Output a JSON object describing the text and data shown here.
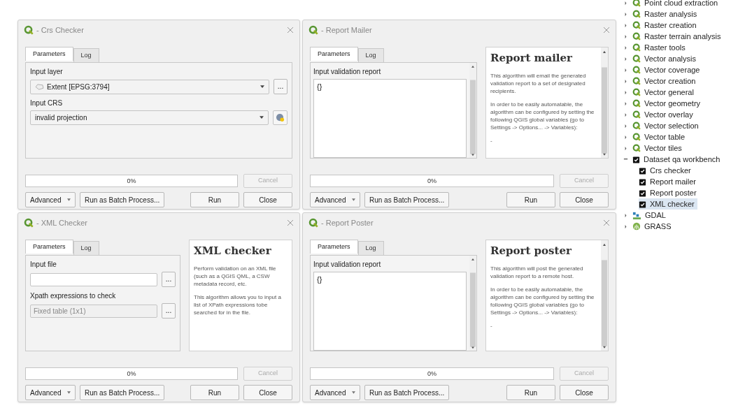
{
  "dialogs": [
    {
      "title": "- Crs Checker",
      "tabs": [
        {
          "label": "Parameters",
          "selected": true
        },
        {
          "label": "Log",
          "selected": false
        }
      ],
      "params": [
        {
          "kind": "layer",
          "label": "Input layer",
          "value": "Extent [EPSG:3794]",
          "browse": "..."
        },
        {
          "kind": "crs",
          "label": "Input CRS",
          "value": "invalid projection"
        }
      ],
      "progress": {
        "text": "0%",
        "level": 0
      },
      "buttons": {
        "advanced": "Advanced",
        "batch": "Run as Batch Process...",
        "run": "Run",
        "close": "Close",
        "cancel": "Cancel",
        "cancel_disabled": true
      }
    },
    {
      "title": "- Report Mailer",
      "tabs": [
        {
          "label": "Parameters",
          "selected": true
        },
        {
          "label": "Log",
          "selected": false
        }
      ],
      "params": [
        {
          "kind": "textarea",
          "label": "Input validation report",
          "value": "{}"
        }
      ],
      "help": {
        "heading": "Report mailer",
        "paragraphs": [
          "This algorithm will email the generated validation report to a set of designated recipients.",
          "In order to be easily automatable, the algorithm can be configured by setting the following QGIS global variables (go to Settings -> Options... -> Variables):",
          "-"
        ]
      },
      "progress": {
        "text": "0%",
        "level": 0
      },
      "buttons": {
        "advanced": "Advanced",
        "batch": "Run as Batch Process...",
        "run": "Run",
        "close": "Close",
        "cancel": "Cancel",
        "cancel_disabled": true
      }
    },
    {
      "title": "- XML Checker",
      "tabs": [
        {
          "label": "Parameters",
          "selected": true
        },
        {
          "label": "Log",
          "selected": false
        }
      ],
      "params": [
        {
          "kind": "file",
          "label": "Input file",
          "browse": "..."
        },
        {
          "kind": "table",
          "label": "Xpath expressions to check",
          "value": "Fixed table (1x1)",
          "disabled": true,
          "browse": "..."
        }
      ],
      "help": {
        "heading": "XML checker",
        "paragraphs": [
          "Perform validation on an XML file (such as a QGIS QML, a CSW metadata record, etc.",
          "This algorithm allows you to input a list of XPath expressions tobe searched for in the file."
        ]
      },
      "progress": {
        "text": "0%",
        "level": 0
      },
      "buttons": {
        "advanced": "Advanced",
        "batch": "Run as Batch Process...",
        "run": "Run",
        "close": "Close",
        "cancel": "Cancel",
        "cancel_disabled": true
      }
    },
    {
      "title": "- Report Poster",
      "tabs": [
        {
          "label": "Parameters",
          "selected": true
        },
        {
          "label": "Log",
          "selected": false
        }
      ],
      "params": [
        {
          "kind": "textarea",
          "label": "Input validation report",
          "value": "{}"
        }
      ],
      "help": {
        "heading": "Report poster",
        "paragraphs": [
          "This algorithm will post the generated validation report to a remote host.",
          "In order to be easily automatable, the algorithm can be configured by setting the following QGIS global variables (go to Settings -> Options... -> Variables):",
          "-"
        ]
      },
      "progress": {
        "text": "0%",
        "level": 0
      },
      "buttons": {
        "advanced": "Advanced",
        "batch": "Run as Batch Process...",
        "run": "Run",
        "close": "Close",
        "cancel": "Cancel",
        "cancel_disabled": true
      }
    }
  ],
  "tree": [
    {
      "kind": "qgis",
      "label": "Point cloud extraction",
      "expanded": false,
      "selected": false
    },
    {
      "kind": "qgis",
      "label": "Raster analysis",
      "expanded": false,
      "selected": false
    },
    {
      "kind": "qgis",
      "label": "Raster creation",
      "expanded": false,
      "selected": false
    },
    {
      "kind": "qgis",
      "label": "Raster terrain analysis",
      "expanded": false,
      "selected": false
    },
    {
      "kind": "qgis",
      "label": "Raster tools",
      "expanded": false,
      "selected": false
    },
    {
      "kind": "qgis",
      "label": "Vector analysis",
      "expanded": false,
      "selected": false
    },
    {
      "kind": "qgis",
      "label": "Vector coverage",
      "expanded": false,
      "selected": false
    },
    {
      "kind": "qgis",
      "label": "Vector creation",
      "expanded": false,
      "selected": false
    },
    {
      "kind": "qgis",
      "label": "Vector general",
      "expanded": false,
      "selected": false
    },
    {
      "kind": "qgis",
      "label": "Vector geometry",
      "expanded": false,
      "selected": false
    },
    {
      "kind": "qgis",
      "label": "Vector overlay",
      "expanded": false,
      "selected": false
    },
    {
      "kind": "qgis",
      "label": "Vector selection",
      "expanded": false,
      "selected": false
    },
    {
      "kind": "qgis",
      "label": "Vector table",
      "expanded": false,
      "selected": false
    },
    {
      "kind": "qgis",
      "label": "Vector tiles",
      "expanded": false,
      "selected": false
    },
    {
      "kind": "script",
      "label": "Dataset qa workbench",
      "expanded": true,
      "selected": false,
      "children": [
        {
          "kind": "script",
          "label": "Crs checker",
          "selected": false
        },
        {
          "kind": "script",
          "label": "Report mailer",
          "selected": false
        },
        {
          "kind": "script",
          "label": "Report poster",
          "selected": false
        },
        {
          "kind": "script",
          "label": "XML checker",
          "selected": true
        }
      ]
    },
    {
      "kind": "gdal",
      "label": "GDAL",
      "expanded": false,
      "selected": false
    },
    {
      "kind": "grass",
      "label": "GRASS",
      "expanded": false,
      "selected": false
    }
  ]
}
